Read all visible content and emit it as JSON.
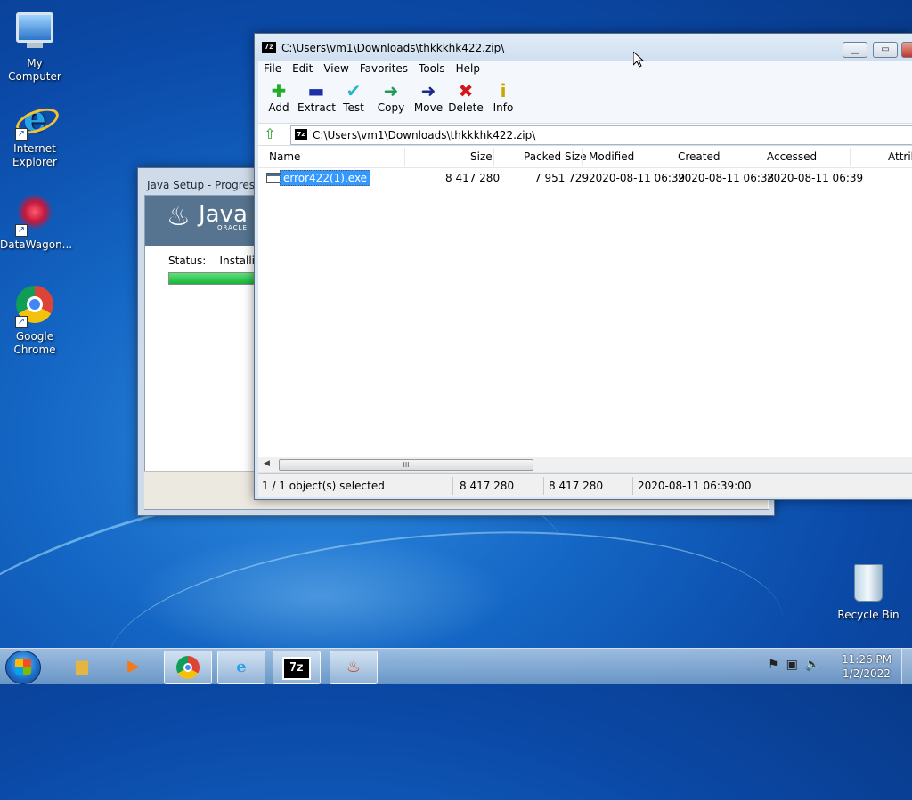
{
  "desktop": {
    "icons": [
      {
        "label": "My Computer"
      },
      {
        "label": "Internet Explorer"
      },
      {
        "label": "DataWagon..."
      },
      {
        "label": "Google Chrome"
      },
      {
        "label": "Recycle Bin"
      }
    ]
  },
  "java_window": {
    "title": "Java Setup - Progress",
    "logo_text": "Java",
    "logo_sub": "ORACLE",
    "status_label": "Status:",
    "status_value": "Installin",
    "progress": 0.15
  },
  "zip_window": {
    "app_icon": "7z",
    "title": "C:\\Users\\vm1\\Downloads\\thkkkhk422.zip\\",
    "menu": [
      "File",
      "Edit",
      "View",
      "Favorites",
      "Tools",
      "Help"
    ],
    "toolbar": [
      {
        "label": "Add",
        "icon": "plus-icon",
        "glyph": "✚",
        "color": "#1fae2a"
      },
      {
        "label": "Extract",
        "icon": "minus-icon",
        "glyph": "▬",
        "color": "#1c2fa8"
      },
      {
        "label": "Test",
        "icon": "check-icon",
        "glyph": "✔",
        "color": "#27b5c9"
      },
      {
        "label": "Copy",
        "icon": "copy-arrow-icon",
        "glyph": "➜",
        "color": "#1d9a5a"
      },
      {
        "label": "Move",
        "icon": "move-arrow-icon",
        "glyph": "➜",
        "color": "#1a2a8c"
      },
      {
        "label": "Delete",
        "icon": "delete-icon",
        "glyph": "✖",
        "color": "#d4161a"
      },
      {
        "label": "Info",
        "icon": "info-icon",
        "glyph": "i",
        "color": "#c6a800"
      }
    ],
    "address": "C:\\Users\\vm1\\Downloads\\thkkkhk422.zip\\",
    "columns": [
      "Name",
      "Size",
      "Packed Size",
      "Modified",
      "Created",
      "Accessed",
      "Attrib"
    ],
    "rows": [
      {
        "name": "error422(1).exe",
        "size": "8 417 280",
        "packed": "7 951 729",
        "modified": "2020-08-11 06:39",
        "created": "2020-08-11 06:38",
        "accessed": "2020-08-11 06:39"
      }
    ],
    "scroll_grip": "III",
    "status": {
      "selected": "1 / 1 object(s) selected",
      "size": "8 417 280",
      "packed": "8 417 280",
      "date": "2020-08-11 06:39:00"
    }
  },
  "taskbar": {
    "items": [
      "File Explorer",
      "Media Player",
      "Google Chrome",
      "Internet Explorer",
      "7-Zip",
      "Java"
    ],
    "clock_time": "11:26 PM",
    "clock_date": "1/2/2022"
  }
}
